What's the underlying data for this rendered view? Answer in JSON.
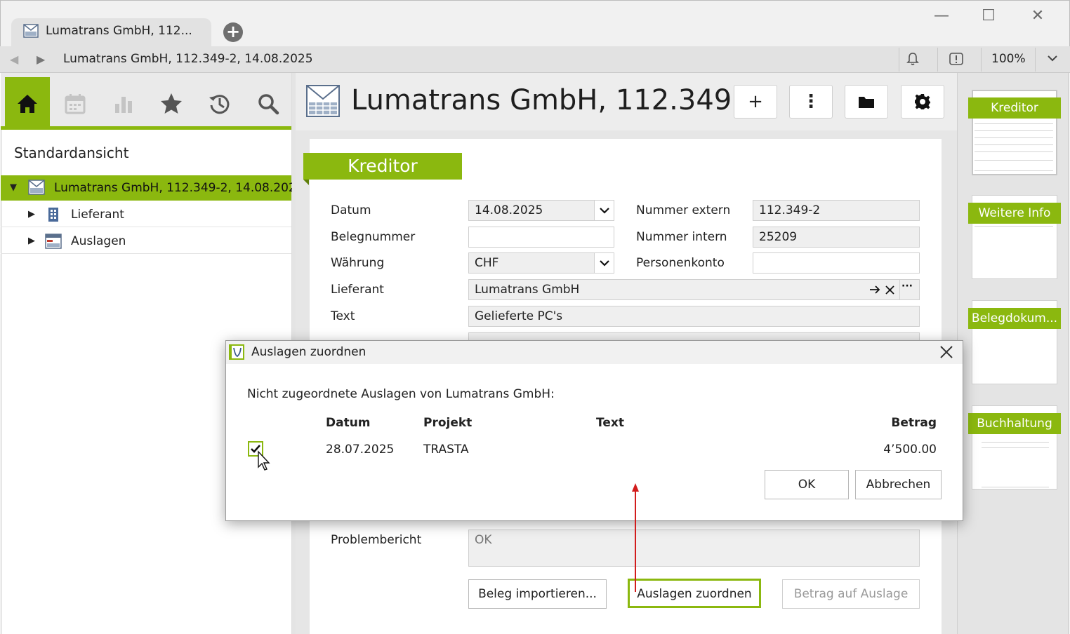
{
  "window": {
    "tab_title": "Lumatrans GmbH, 112...",
    "new_tab_label": "+",
    "minimize_label": "—",
    "maximize_label": "☐",
    "close_label": "✕"
  },
  "address": {
    "back_label": "◀",
    "forward_label": "▶",
    "path": "Lumatrans GmbH, 112.349-2, 14.08.2025",
    "zoom": "100%"
  },
  "sidebar": {
    "toolbar_icons": [
      "home-icon",
      "calendar-icon",
      "bar-chart-icon",
      "star-icon",
      "history-icon",
      "search-icon"
    ],
    "view_label": "Standardansicht",
    "tree": {
      "root_label": "Lumatrans GmbH, 112.349-2, 14.08.2025",
      "children": [
        {
          "label": "Lieferant",
          "icon": "building-icon"
        },
        {
          "label": "Auslagen",
          "icon": "expenses-icon"
        }
      ]
    }
  },
  "document": {
    "title": "Lumatrans GmbH, 112.349...",
    "header_buttons": {
      "add": "+",
      "more": "⋮",
      "folder": "folder-icon",
      "settings": "gear-icon"
    },
    "section_title": "Kreditor",
    "fields": {
      "datum_label": "Datum",
      "datum_value": "14.08.2025",
      "belegnummer_label": "Belegnummer",
      "belegnummer_value": "",
      "waehrung_label": "Währung",
      "waehrung_value": "CHF",
      "lieferant_label": "Lieferant",
      "lieferant_value": "Lumatrans GmbH",
      "lieferant_more": "···",
      "text_label": "Text",
      "text_value": "Gelieferte PC's",
      "nummer_extern_label": "Nummer extern",
      "nummer_extern_value": "112.349-2",
      "nummer_intern_label": "Nummer intern",
      "nummer_intern_value": "25209",
      "personenkonto_label": "Personenkonto",
      "personenkonto_value": "",
      "problembericht_label": "Problembericht",
      "problembericht_value": "OK"
    },
    "buttons": {
      "import": "Beleg importieren...",
      "assign": "Auslagen zuordnen",
      "amount": "Betrag auf Auslage"
    }
  },
  "thumbnails": [
    {
      "label": "Kreditor"
    },
    {
      "label": "Weitere Info"
    },
    {
      "label": "Belegdokum..."
    },
    {
      "label": "Buchhaltung"
    }
  ],
  "dialog": {
    "title": "Auslagen zuordnen",
    "message": "Nicht zugeordnete Auslagen von Lumatrans GmbH:",
    "columns": {
      "datum": "Datum",
      "projekt": "Projekt",
      "text": "Text",
      "betrag": "Betrag"
    },
    "rows": [
      {
        "checked": true,
        "datum": "28.07.2025",
        "projekt": "TRASTA",
        "text": "",
        "betrag": "4’500.00"
      }
    ],
    "ok_label": "OK",
    "cancel_label": "Abbrechen"
  },
  "colors": {
    "accent_green": "#8bb80f",
    "annotation_red": "#d21c1c"
  }
}
